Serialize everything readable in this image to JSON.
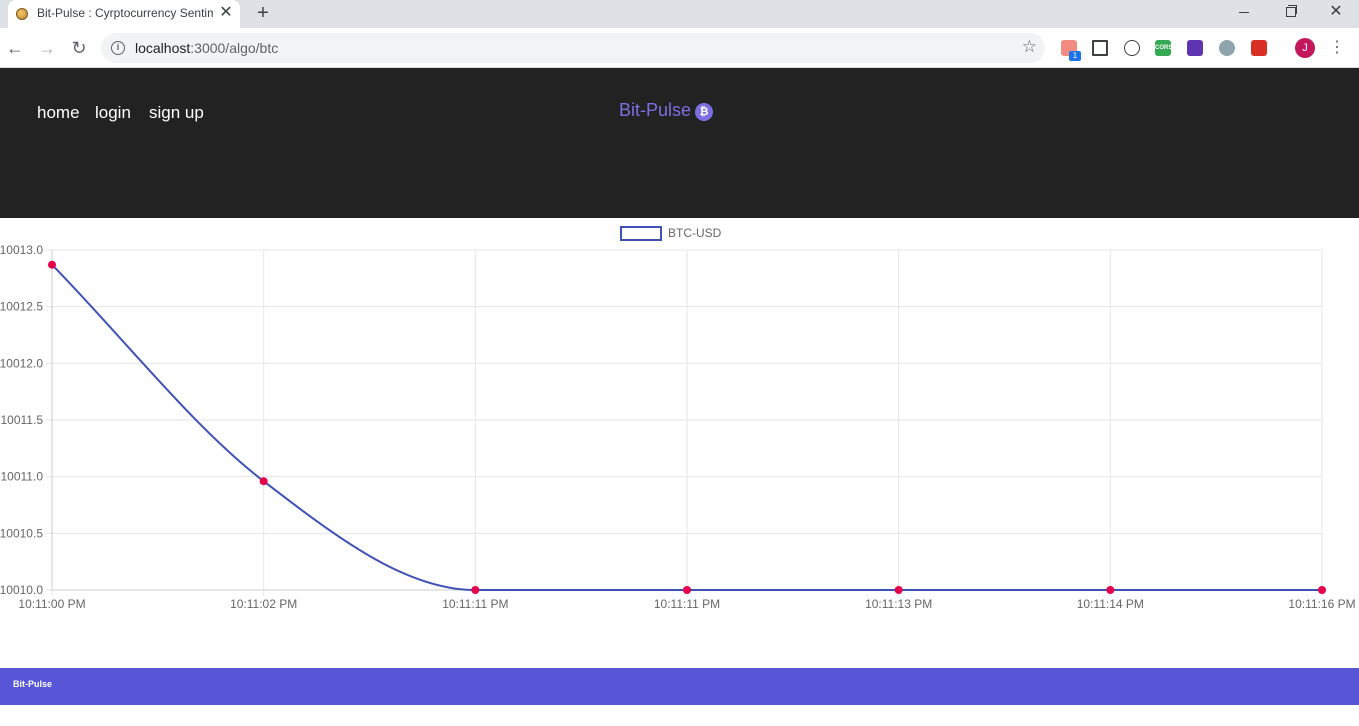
{
  "browser": {
    "tab_title": "Bit-Pulse : Cyrptocurrency Sentim",
    "url_host": "localhost",
    "url_path": ":3000/algo/btc",
    "profile_initial": "J",
    "extension_badge": "1",
    "extension_cors_label": "CORS"
  },
  "header": {
    "nav": [
      "home",
      "login",
      "sign up"
    ],
    "brand": "Bit-Pulse",
    "brand_icon": "bitcoin-icon"
  },
  "chart_data": {
    "type": "line",
    "title": "",
    "xlabel": "",
    "ylabel": "",
    "categories": [
      "10:11:00 PM",
      "10:11:02 PM",
      "10:11:11 PM",
      "10:11:11 PM",
      "10:11:13 PM",
      "10:11:14 PM",
      "10:11:16 PM"
    ],
    "series": [
      {
        "name": "BTC-USD",
        "values": [
          10012.87,
          10010.96,
          10010.0,
          10010.0,
          10010.0,
          10010.0,
          10010.0
        ]
      }
    ],
    "ylim": [
      10010.0,
      10013.0
    ],
    "yticks": [
      "10013.0",
      "10012.5",
      "10012.0",
      "10011.5",
      "10011.0",
      "10010.5",
      "10010.0"
    ],
    "legend": "top-center",
    "grid": true,
    "line_color": "#3f51b5",
    "point_color": "#e6004c"
  },
  "footer": {
    "brand": "Bit-Pulse"
  }
}
